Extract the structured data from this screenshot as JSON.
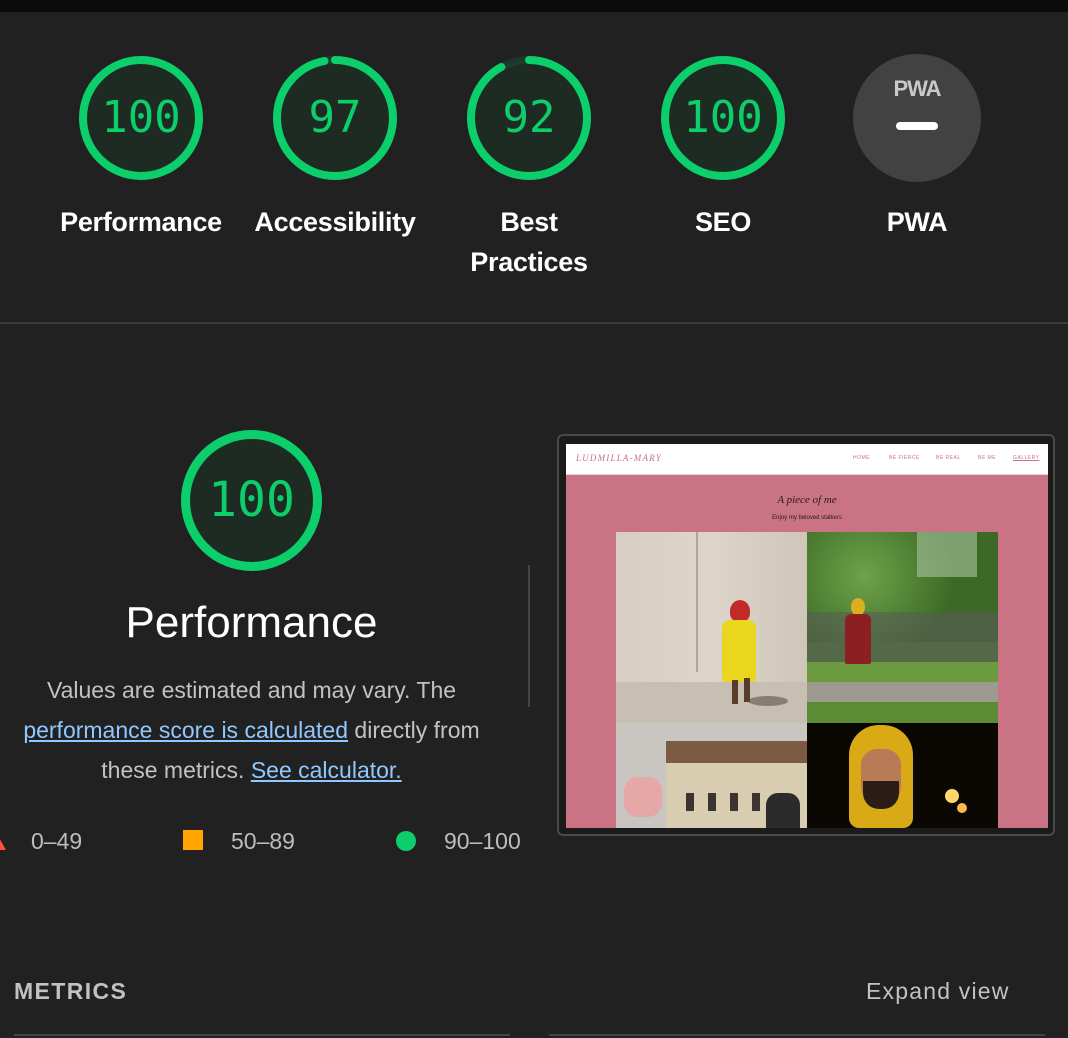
{
  "colors": {
    "pass": "#0cce6b",
    "average": "#ffa400",
    "fail": "#ff4e42",
    "link": "#90c8ff",
    "background": "#212121"
  },
  "gauges": [
    {
      "score": "100",
      "label": "Performance",
      "fraction": 1.0
    },
    {
      "score": "97",
      "label": "Accessibility",
      "fraction": 0.97
    },
    {
      "score": "92",
      "label": "Best Practices",
      "fraction": 0.92
    },
    {
      "score": "100",
      "label": "SEO",
      "fraction": 1.0
    }
  ],
  "pwa": {
    "badge_text": "PWA",
    "label": "PWA",
    "icon": "pwa-dash-icon"
  },
  "performance": {
    "score": "100",
    "fraction": 1.0,
    "title": "Performance",
    "desc_part1": "Values are estimated and may vary. The",
    "desc_link1": "performance score is calculated",
    "desc_part2": "directly from",
    "desc_part3": "these metrics.",
    "desc_link2": "See calculator."
  },
  "legend": [
    {
      "range": "0–49",
      "icon": "fail-triangle-icon"
    },
    {
      "range": "50–89",
      "icon": "average-square-icon"
    },
    {
      "range": "90–100",
      "icon": "pass-circle-icon"
    }
  ],
  "screenshot": {
    "brand": "LUDMILLA-MARY",
    "nav": [
      "HOME",
      "BE FIERCE",
      "BE REAL",
      "BE ME",
      "GALLERY"
    ],
    "heading": "A piece of me",
    "subheading": "Enjoy my beloved stalkers"
  },
  "metrics_header": {
    "title": "METRICS",
    "expand": "Expand view"
  }
}
